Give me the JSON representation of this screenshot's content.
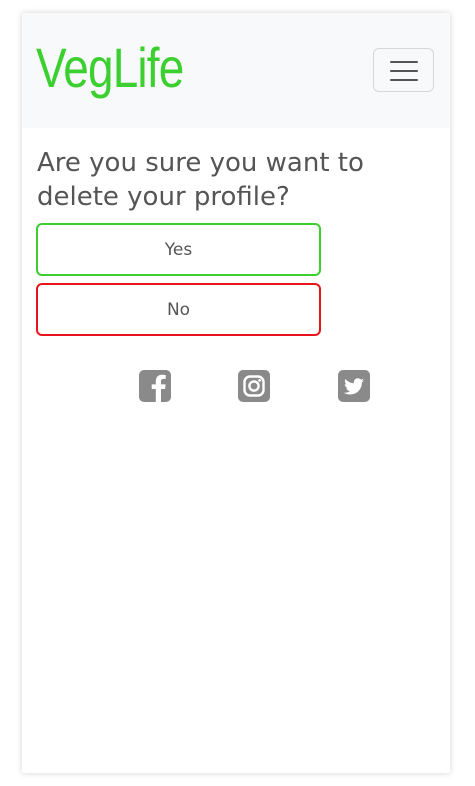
{
  "navbar": {
    "brand": "VegLife",
    "toggler_icon": "hamburger-menu-icon"
  },
  "main": {
    "question": "Are you sure you want to delete your profile?",
    "yes_label": "Yes",
    "no_label": "No"
  },
  "footer": {
    "social": [
      {
        "name": "facebook",
        "icon": "facebook-square-icon"
      },
      {
        "name": "instagram",
        "icon": "instagram-square-icon"
      },
      {
        "name": "twitter",
        "icon": "twitter-square-icon"
      }
    ]
  },
  "colors": {
    "brand": "#3ccf30",
    "yes_border": "#3ccf30",
    "no_border": "#e8141b",
    "text": "#555555",
    "icon": "#8a8a8a",
    "navbar_bg": "#f8f9fa"
  }
}
